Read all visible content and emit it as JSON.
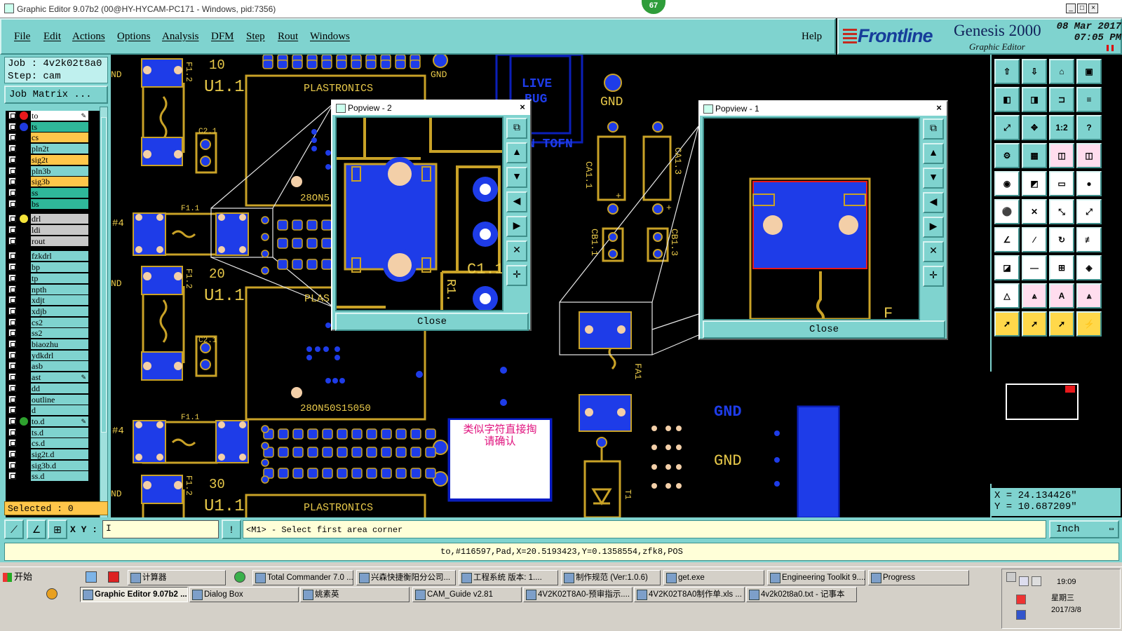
{
  "window": {
    "title": "Graphic Editor 9.07b2 (00@HY-HYCAM-PC171 - Windows, pid:7356)",
    "badge": "67"
  },
  "menu": {
    "items": [
      "File",
      "Edit",
      "Actions",
      "Options",
      "Analysis",
      "DFM",
      "Step",
      "Rout",
      "Windows"
    ],
    "help": "Help"
  },
  "brand": {
    "logo": "Frontline",
    "product": "Genesis 2000",
    "subtitle": "Graphic Editor",
    "date": "08 Mar 2017",
    "time": "07:05 PM"
  },
  "job": {
    "job_line": "Job : 4v2k02t8a0",
    "step_line": "Step: cam",
    "matrix_button": "Job Matrix ..."
  },
  "layers": [
    {
      "name": "to",
      "color": "#ffffff",
      "dot": "#e8191c",
      "edit": true
    },
    {
      "name": "ts",
      "color": "#2fb89a",
      "dot": "#1f3be0",
      "edit": false
    },
    {
      "name": "cs",
      "color": "#ffc64a",
      "dot": "",
      "edit": false
    },
    {
      "name": "pln2t",
      "color": "#7fd3cf",
      "dot": "",
      "edit": false
    },
    {
      "name": "sig2t",
      "color": "#ffc64a",
      "dot": "",
      "edit": false
    },
    {
      "name": "pln3b",
      "color": "#7fd3cf",
      "dot": "",
      "edit": false
    },
    {
      "name": "sig3b",
      "color": "#ffc64a",
      "dot": "",
      "edit": false
    },
    {
      "name": "ss",
      "color": "#2fb89a",
      "dot": "",
      "edit": false
    },
    {
      "name": "bs",
      "color": "#2fb89a",
      "dot": "",
      "edit": false
    },
    {
      "name": "drl",
      "color": "#c8c8c8",
      "dot": "#f5e43a",
      "edit": false
    },
    {
      "name": "ldi",
      "color": "#c8c8c8",
      "dot": "",
      "edit": false
    },
    {
      "name": "rout",
      "color": "#c8c8c8",
      "dot": "",
      "edit": false
    },
    {
      "name": "fzkdrl",
      "color": "#7fd3cf",
      "dot": "",
      "edit": false
    },
    {
      "name": "bp",
      "color": "#7fd3cf",
      "dot": "",
      "edit": false
    },
    {
      "name": "tp",
      "color": "#7fd3cf",
      "dot": "",
      "edit": false
    },
    {
      "name": "npth",
      "color": "#7fd3cf",
      "dot": "",
      "edit": false
    },
    {
      "name": "xdjt",
      "color": "#7fd3cf",
      "dot": "",
      "edit": false
    },
    {
      "name": "xdjb",
      "color": "#7fd3cf",
      "dot": "",
      "edit": false
    },
    {
      "name": "cs2",
      "color": "#7fd3cf",
      "dot": "",
      "edit": false
    },
    {
      "name": "ss2",
      "color": "#7fd3cf",
      "dot": "",
      "edit": false
    },
    {
      "name": "biaozhu",
      "color": "#7fd3cf",
      "dot": "",
      "edit": false
    },
    {
      "name": "ydkdrl",
      "color": "#7fd3cf",
      "dot": "",
      "edit": false
    },
    {
      "name": "asb",
      "color": "#7fd3cf",
      "dot": "",
      "edit": false
    },
    {
      "name": "ast",
      "color": "#7fd3cf",
      "dot": "",
      "edit": true
    },
    {
      "name": "dd",
      "color": "#7fd3cf",
      "dot": "",
      "edit": false
    },
    {
      "name": "outline",
      "color": "#7fd3cf",
      "dot": "",
      "edit": false
    },
    {
      "name": "d",
      "color": "#7fd3cf",
      "dot": "",
      "edit": false
    },
    {
      "name": "to.d",
      "color": "#7fd3cf",
      "dot": "#2ea12e",
      "edit": true
    },
    {
      "name": "ts.d",
      "color": "#7fd3cf",
      "dot": "",
      "edit": false
    },
    {
      "name": "cs.d",
      "color": "#7fd3cf",
      "dot": "",
      "edit": false
    },
    {
      "name": "sig2t.d",
      "color": "#7fd3cf",
      "dot": "",
      "edit": false
    },
    {
      "name": "sig3b.d",
      "color": "#7fd3cf",
      "dot": "",
      "edit": false
    },
    {
      "name": "ss.d",
      "color": "#7fd3cf",
      "dot": "",
      "edit": false
    }
  ],
  "selected": "Selected : 0",
  "board_labels": {
    "plastronics": "PLASTRONICS",
    "part_28on": "28ON50S15050",
    "part_28on_partial": "28ON5",
    "plas_partial": "PLAS",
    "u1_1": "U1.1",
    "num_10": "10",
    "num_20": "20",
    "num_30": "30",
    "gnd": "GND",
    "nd": "ND",
    "live_bug_1": "LIVE",
    "live_bug_2": "BUG",
    "tofn": "N TOFN",
    "ca1_1": "CA1.1",
    "ca1_3": "CA1.3",
    "cb1_1": "CB1.1",
    "cb1_3": "CB1.3",
    "fa1": "FA1",
    "f1_1": "F1.1",
    "f1_2": "F1.2",
    "c2_1": "C2.1",
    "hash4": "#4",
    "t1": "T1",
    "c1_1": "C1.1",
    "r1": "R1.",
    "plus": "+"
  },
  "note": {
    "line1": "类似字符直接掏",
    "line2": "请确认"
  },
  "popview1": {
    "title": "Popview - 1",
    "close": "Close",
    "label_f": "F"
  },
  "popview2": {
    "title": "Popview - 2",
    "close": "Close",
    "label_c": "C1.1",
    "label_r": "R1."
  },
  "tools": {
    "row_labels": [
      "1:2",
      "?"
    ]
  },
  "coords": {
    "x": "X = 24.134426\"",
    "y": "Y = 10.687209\""
  },
  "command": {
    "xy_label": "X Y :",
    "xy_value": "I",
    "prompt": "<M1> - Select first area corner",
    "unit": "Inch"
  },
  "status": "to,#116597,Pad,X=20.5193423,Y=0.1358554,zfk8,POS",
  "taskbar": {
    "start": "开始",
    "row1": [
      "计算器",
      "Total Commander 7.0 ...",
      "兴森快捷衡阳分公司...",
      "工程系统  版本: 1....",
      "制作规范 (Ver:1.0.6)",
      "get.exe",
      "Engineering Toolkit 9....",
      "Progress"
    ],
    "row2": [
      "Graphic Editor 9.07b2 ...",
      "Dialog Box",
      "姚素英",
      "CAM_Guide v2.81",
      "4V2K02T8A0-预审指示....",
      "4V2K02T8A0制作单.xls ...",
      "4v2k02t8a0.txt - 记事本"
    ],
    "clock_time": "19:09",
    "clock_day": "星期三",
    "clock_date": "2017/3/8"
  },
  "colors": {
    "panel": "#7fd3cf",
    "pad_blue": "#1e3ce8",
    "trace_gold": "#c9a227",
    "pad_hole": "#f3cfa8",
    "accent_orange": "#ffc64a"
  }
}
